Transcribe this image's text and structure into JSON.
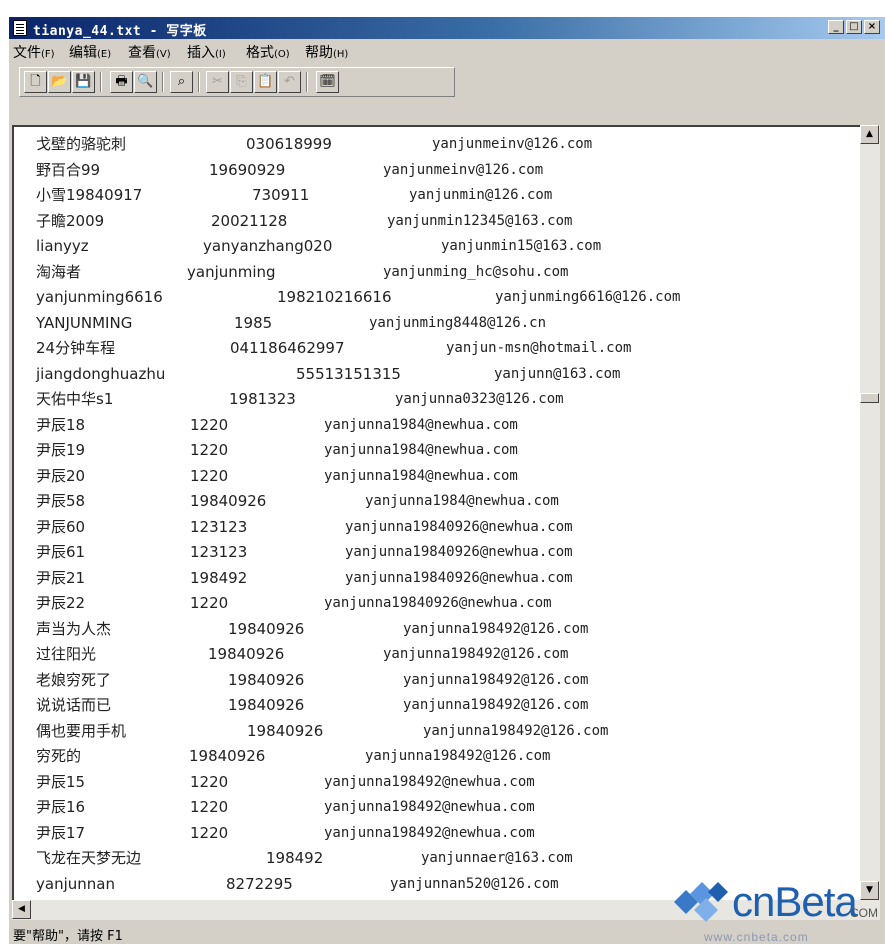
{
  "window": {
    "title": "tianya_44.txt - 写字板",
    "controls": [
      "_",
      "□",
      "×"
    ]
  },
  "menu": [
    {
      "label": "文件",
      "accel": "(F)"
    },
    {
      "label": "编辑",
      "accel": "(E)"
    },
    {
      "label": "查看",
      "accel": "(V)"
    },
    {
      "label": "插入",
      "accel": "(I)"
    },
    {
      "label": "格式",
      "accel": "(O)"
    },
    {
      "label": "帮助",
      "accel": "(H)"
    }
  ],
  "toolbar": {
    "buttons": [
      {
        "icon": "new-document-icon",
        "glyph": "🗋",
        "enabled": true
      },
      {
        "icon": "open-folder-icon",
        "glyph": "📂",
        "enabled": true
      },
      {
        "icon": "save-icon",
        "glyph": "💾",
        "enabled": true
      },
      {
        "icon": "print-icon",
        "glyph": "🖶",
        "enabled": true
      },
      {
        "icon": "print-preview-icon",
        "glyph": "🔍",
        "enabled": true
      },
      {
        "icon": "find-icon",
        "glyph": "⌕",
        "enabled": true
      },
      {
        "icon": "cut-icon",
        "glyph": "✂",
        "enabled": false
      },
      {
        "icon": "copy-icon",
        "glyph": "⎘",
        "enabled": false
      },
      {
        "icon": "paste-icon",
        "glyph": "📋",
        "enabled": true
      },
      {
        "icon": "undo-icon",
        "glyph": "↶",
        "enabled": false
      },
      {
        "icon": "insert-datetime-icon",
        "glyph": "🗓",
        "enabled": true
      }
    ]
  },
  "document": {
    "lines": [
      {
        "name": "戈壁的骆驼刺",
        "pass": "030618999",
        "mail": "yanjunmeinv@126.com"
      },
      {
        "name": "野百合99",
        "pass": "19690929",
        "mail": "yanjunmeinv@126.com"
      },
      {
        "name": "小雪19840917",
        "pass": "730911",
        "mail": "yanjunmin@126.com"
      },
      {
        "name": "子瞻2009",
        "pass": "20021128",
        "mail": "yanjunmin12345@163.com"
      },
      {
        "name": "lianyyz",
        "pass": "yanyanzhang020",
        "mail": "yanjunmin15@163.com"
      },
      {
        "name": "淘海者",
        "pass": "yanjunming",
        "mail": "yanjunming_hc@sohu.com"
      },
      {
        "name": "yanjunming6616",
        "pass": "198210216616",
        "mail": "yanjunming6616@126.com"
      },
      {
        "name": "YANJUNMING",
        "pass": "1985",
        "mail": "yanjunming8448@126.cn"
      },
      {
        "name": "24分钟车程",
        "pass": "041186462997",
        "mail": "yanjun-msn@hotmail.com"
      },
      {
        "name": "jiangdonghuazhu",
        "pass": "55513151315",
        "mail": "yanjunn@163.com"
      },
      {
        "name": "天佑中华s1",
        "pass": "1981323",
        "mail": "yanjunna0323@126.com"
      },
      {
        "name": "尹辰18",
        "pass": "1220",
        "mail": "yanjunna1984@newhua.com"
      },
      {
        "name": "尹辰19",
        "pass": "1220",
        "mail": "yanjunna1984@newhua.com"
      },
      {
        "name": "尹辰20",
        "pass": "1220",
        "mail": "yanjunna1984@newhua.com"
      },
      {
        "name": "尹辰58",
        "pass": "19840926",
        "mail": "yanjunna1984@newhua.com"
      },
      {
        "name": "尹辰60",
        "pass": "123123",
        "mail": "yanjunna19840926@newhua.com"
      },
      {
        "name": "尹辰61",
        "pass": "123123",
        "mail": "yanjunna19840926@newhua.com"
      },
      {
        "name": "尹辰21",
        "pass": "198492",
        "mail": "yanjunna19840926@newhua.com"
      },
      {
        "name": "尹辰22",
        "pass": "1220",
        "mail": "yanjunna19840926@newhua.com"
      },
      {
        "name": "声当为人杰",
        "pass": "19840926",
        "mail": "yanjunna198492@126.com"
      },
      {
        "name": "过往阳光",
        "pass": "19840926",
        "mail": "yanjunna198492@126.com"
      },
      {
        "name": "老娘穷死了",
        "pass": "19840926",
        "mail": "yanjunna198492@126.com"
      },
      {
        "name": "说说话而已",
        "pass": "19840926",
        "mail": "yanjunna198492@126.com"
      },
      {
        "name": "偶也要用手机",
        "pass": "19840926",
        "mail": "yanjunna198492@126.com"
      },
      {
        "name": "穷死的",
        "pass": "19840926",
        "mail": "yanjunna198492@126.com"
      },
      {
        "name": "尹辰15",
        "pass": "1220",
        "mail": "yanjunna198492@newhua.com"
      },
      {
        "name": "尹辰16",
        "pass": "1220",
        "mail": "yanjunna198492@newhua.com"
      },
      {
        "name": "尹辰17",
        "pass": "1220",
        "mail": "yanjunna198492@newhua.com"
      },
      {
        "name": "飞龙在天梦无边",
        "pass": "198492",
        "mail": "yanjunnaer@163.com"
      },
      {
        "name": "yanjunnan",
        "pass": "8272295",
        "mail": "yanjunnan520@126.com"
      }
    ]
  },
  "statusbar": {
    "text": "要\"帮助\"，请按 F1"
  },
  "watermark": {
    "brand": "cnBeta",
    "suffix": "COM",
    "url": "www.cnbeta.com",
    "brand_color": "#1e5fb0"
  },
  "colors": {
    "titlebar_start": "#0a246a",
    "titlebar_end": "#a6caf0",
    "chrome": "#d4d0c8"
  }
}
